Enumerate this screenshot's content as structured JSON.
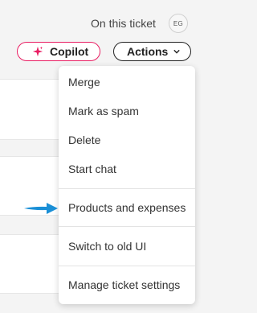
{
  "header": {
    "ticket_label": "On this ticket",
    "avatar_initials": "EG"
  },
  "toolbar": {
    "copilot_label": "Copilot",
    "actions_label": "Actions"
  },
  "menu": {
    "items": [
      {
        "label": "Merge"
      },
      {
        "label": "Mark as spam"
      },
      {
        "label": "Delete"
      },
      {
        "label": "Start chat"
      },
      {
        "label": "Products and expenses"
      },
      {
        "label": "Switch to old UI"
      },
      {
        "label": "Manage ticket settings"
      }
    ]
  },
  "colors": {
    "copilot_accent": "#e91e63",
    "arrow": "#1a8fd6"
  },
  "icons": [
    "sparkle-icon",
    "chevron-down-icon",
    "pointer-arrow-icon"
  ]
}
